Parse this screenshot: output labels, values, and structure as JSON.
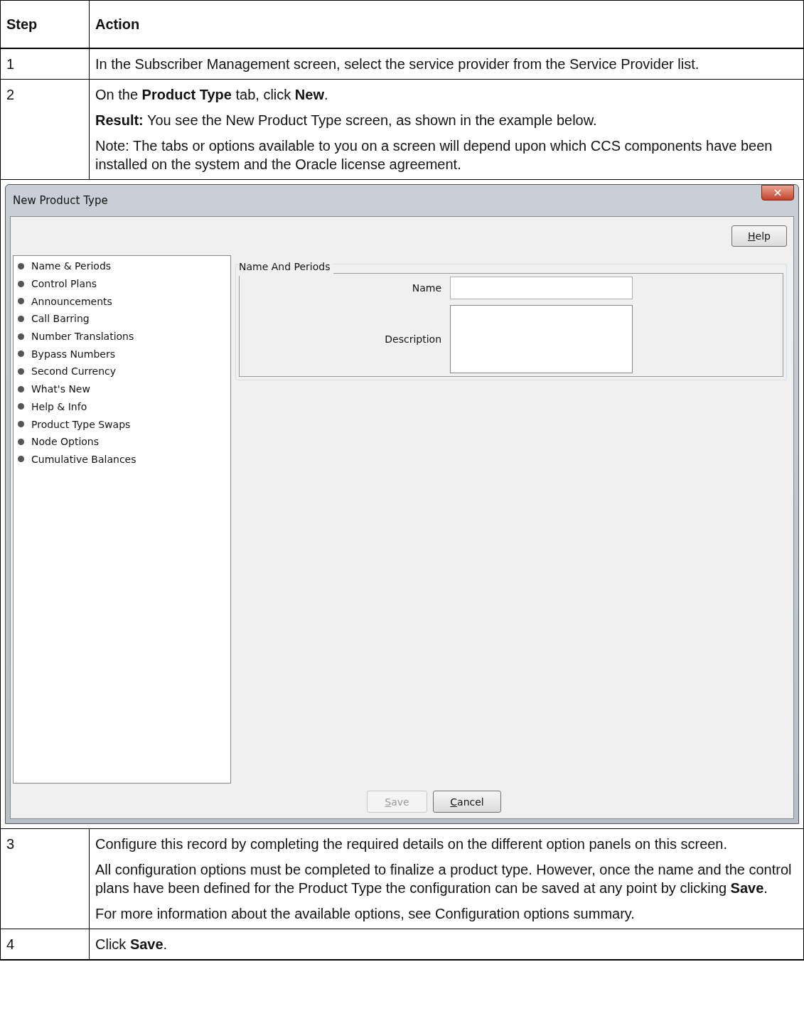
{
  "table": {
    "columns": [
      "Step",
      "Action"
    ],
    "rows": [
      {
        "kind": "step",
        "step": "1",
        "paragraphs": [
          "In the Subscriber Management screen, select the service provider from the Service Provider list."
        ]
      },
      {
        "kind": "step",
        "step": "2",
        "paragraphs": [
          "On the **Product Type** tab, click **New**.",
          "**Result:** You see the New Product Type screen, as shown in the example below.",
          "Note: The tabs or options available to you on a screen will depend upon which CCS components have been installed on the system and the Oracle license agreement."
        ]
      },
      {
        "kind": "screenshot",
        "dialog": {
          "title": "New Product Type",
          "help_button": "Help",
          "options": [
            "Name & Periods",
            "Control Plans",
            "Announcements",
            "Call Barring",
            "Number Translations",
            "Bypass Numbers",
            "Second Currency",
            "What's New",
            "Help & Info",
            "Product Type Swaps",
            "Node Options",
            "Cumulative Balances"
          ],
          "group_title": "Name And Periods",
          "fields": [
            {
              "kind": "line",
              "label": "Name"
            },
            {
              "kind": "area",
              "label": "Description"
            }
          ],
          "buttons": [
            {
              "label": "Save",
              "disabled": true
            },
            {
              "label": "Cancel",
              "disabled": false
            }
          ]
        }
      },
      {
        "kind": "step",
        "step": "3",
        "paragraphs": [
          "Configure this record by completing the required details on the different option panels on this screen.",
          "All configuration options must be completed to finalize a product type. However, once the name and the control plans have been defined for the Product Type the configuration can be saved at any point by clicking **Save**.",
          "For more information about the available options, see Configuration options summary."
        ]
      },
      {
        "kind": "step",
        "step": "4",
        "paragraphs": [
          "Click **Save**."
        ]
      }
    ]
  }
}
